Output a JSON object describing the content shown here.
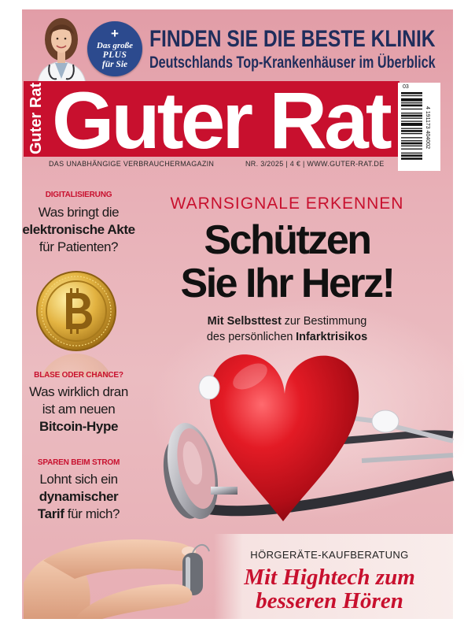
{
  "colors": {
    "masthead_red": "#c8102e",
    "kicker_red": "#c8102e",
    "promo_navy": "#1f2d5c",
    "badge_blue": "#2c4a8e",
    "headline_black": "#111111",
    "heart_red": "#e31b25"
  },
  "promo": {
    "badge": {
      "plus": "+",
      "line1": "Das große",
      "line2": "PLUS",
      "line3": "für Sie"
    },
    "headline": "FINDEN SIE DIE BESTE KLINIK",
    "subline": "Deutschlands Top-Krankenhäuser im Überblick",
    "image": "doctor-portrait"
  },
  "masthead": {
    "title": "Guter Rat",
    "spine_title": "Guter Rat",
    "tagline": "DAS UNABHÄNGIGE VERBRAUCHERMAGAZIN",
    "issue_info": "NR. 3/2025 | 4 € | WWW.GUTER-RAT.DE",
    "barcode": {
      "issue_code": "03",
      "number": "4 191173 404002"
    }
  },
  "sidebar": {
    "items": [
      {
        "kicker": "DIGITALISIERUNG",
        "lines": [
          "Was bringt die",
          "elektronische Akte",
          "für Patienten?"
        ]
      },
      {
        "kicker": "BLASE ODER CHANCE?",
        "image": "bitcoin-coin",
        "lines": [
          "Was wirklich dran",
          "ist am neuen",
          "Bitcoin-Hype"
        ]
      },
      {
        "kicker": "SPAREN BEIM STROM",
        "lines": [
          "Lohnt sich ein",
          "dynamischer"
        ],
        "last_line": {
          "emphasis": "Tarif",
          "rest": "für mich?"
        }
      }
    ]
  },
  "cover_story": {
    "kicker": "WARNSIGNALE ERKENNEN",
    "title": [
      "Schützen",
      "Sie Ihr Herz!"
    ],
    "dek": [
      {
        "emphasis": "Mit Selbsttest",
        "rest": "zur Bestimmung"
      },
      {
        "rest": "des persönlichen",
        "emphasis": "Infarktrisikos"
      }
    ],
    "image": "heart-with-stethoscope"
  },
  "feature": {
    "kicker": "HÖRGERÄTE-KAUFBERATUNG",
    "title": [
      "Mit Hightech zum",
      "besseren Hören"
    ],
    "image": "hand-holding-hearing-aid"
  }
}
